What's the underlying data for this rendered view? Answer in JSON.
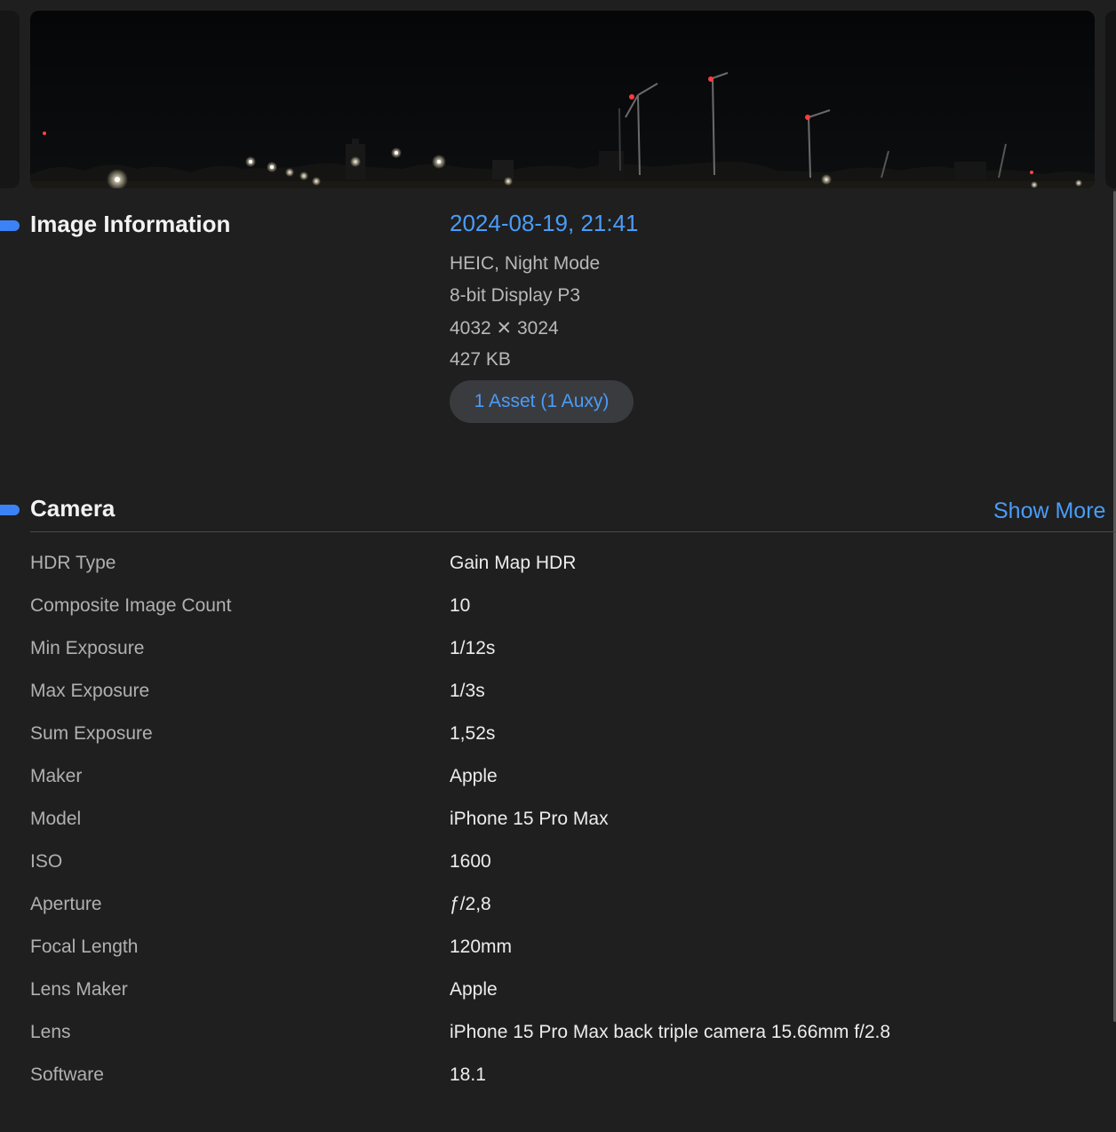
{
  "image_information": {
    "title": "Image Information",
    "date": "2024-08-19, 21:41",
    "details": [
      "HEIC, Night Mode",
      "8-bit Display P3",
      "4032 ✕ 3024",
      "427 KB"
    ],
    "asset_button": "1 Asset (1 Auxy)"
  },
  "camera": {
    "title": "Camera",
    "show_more": "Show More",
    "rows": [
      {
        "label": "HDR Type",
        "value": "Gain Map HDR"
      },
      {
        "label": "Composite Image Count",
        "value": "10"
      },
      {
        "label": "Min Exposure",
        "value": "1/12s"
      },
      {
        "label": "Max Exposure",
        "value": "1/3s"
      },
      {
        "label": "Sum Exposure",
        "value": "1,52s"
      },
      {
        "label": "Maker",
        "value": "Apple"
      },
      {
        "label": "Model",
        "value": "iPhone 15 Pro Max"
      },
      {
        "label": "ISO",
        "value": "1600"
      },
      {
        "label": "Aperture",
        "value": "ƒ/2,8"
      },
      {
        "label": "Focal Length",
        "value": "120mm"
      },
      {
        "label": "Lens Maker",
        "value": "Apple"
      },
      {
        "label": "Lens",
        "value": "iPhone 15 Pro Max back triple camera 15.66mm f/2.8"
      },
      {
        "label": "Software",
        "value": "18.1"
      }
    ]
  },
  "colors": {
    "accent": "#4a9cf8",
    "background": "#1f1f1f",
    "marker": "#3b82f6"
  }
}
